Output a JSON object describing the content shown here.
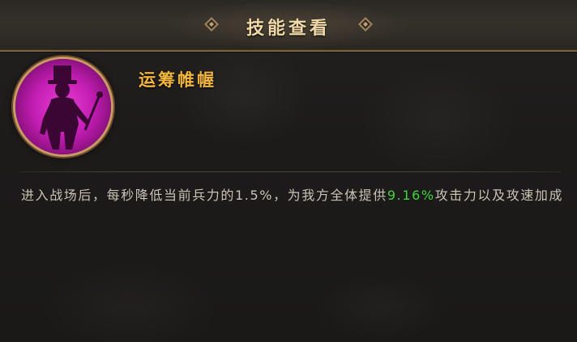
{
  "header": {
    "title": "技能查看"
  },
  "skill": {
    "name": "运筹帷幄",
    "icon": "hero-silhouette-skill-icon",
    "description": {
      "part1": "进入战场后，每秒降低当前兵力的",
      "value1": "1.5%",
      "part2": "，为我方全体提供",
      "value2": "9.16%",
      "part3": "攻击力以及攻速加成"
    }
  },
  "colors": {
    "title": "#f1d9a8",
    "skill_name": "#f2b53d",
    "highlight": "#3fd43a",
    "icon_glow": "#e93fd5"
  }
}
